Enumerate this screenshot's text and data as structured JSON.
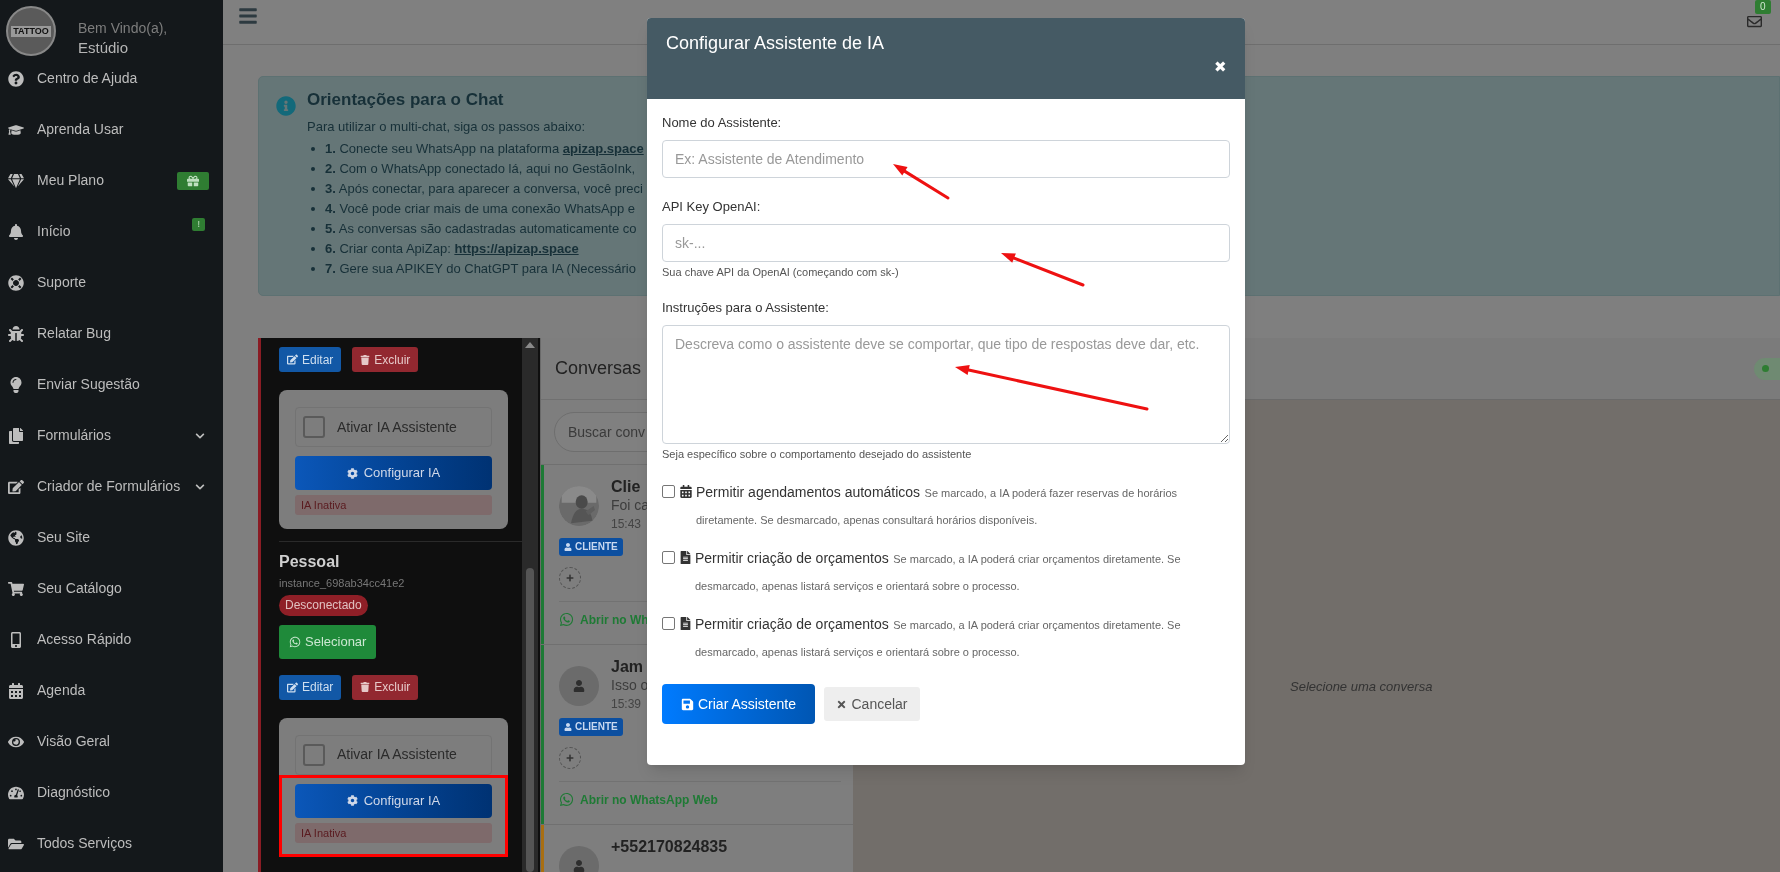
{
  "sidebar": {
    "logo_text": "TATTOO",
    "greeting": "Bem Vindo(a),",
    "user": "Estúdio",
    "items": [
      {
        "label": "Centro de Ajuda",
        "expandable": false
      },
      {
        "label": "Aprenda Usar",
        "expandable": false
      },
      {
        "label": "Meu Plano",
        "expandable": false,
        "badge": {
          "kind": "gift"
        }
      },
      {
        "label": "Início",
        "expandable": false,
        "badge": {
          "kind": "text",
          "text": "!"
        }
      },
      {
        "label": "Suporte",
        "expandable": false
      },
      {
        "label": "Relatar Bug",
        "expandable": false
      },
      {
        "label": "Enviar Sugestão",
        "expandable": false
      },
      {
        "label": "Formulários",
        "expandable": true
      },
      {
        "label": "Criador de Formulários",
        "expandable": true
      },
      {
        "label": "Seu Site",
        "expandable": false
      },
      {
        "label": "Seu Catálogo",
        "expandable": false
      },
      {
        "label": "Acesso Rápido",
        "expandable": false
      },
      {
        "label": "Agenda",
        "expandable": false
      },
      {
        "label": "Visão Geral",
        "expandable": false
      },
      {
        "label": "Diagnóstico",
        "expandable": false
      },
      {
        "label": "Todos Serviços",
        "expandable": false
      }
    ]
  },
  "topbar": {
    "mail_count": "0"
  },
  "guide": {
    "title": "Orientações para o Chat",
    "intro": "Para utilizar o multi-chat, siga os passos abaixo:",
    "steps": [
      {
        "number": "1.",
        "text": "Conecte seu WhatsApp na plataforma",
        "link": "apizap.space"
      },
      {
        "number": "2.",
        "text": "Com o WhatsApp conectado lá, aqui no GestãoInk,"
      },
      {
        "number": "3.",
        "text": "Após conectar, para aparecer a conversa, você preci"
      },
      {
        "number": "4.",
        "text": "Você pode criar mais de uma conexão WhatsApp e"
      },
      {
        "number": "5.",
        "text": "As conversas são cadastradas automaticamente co"
      },
      {
        "number": "6.",
        "text": "Criar conta ApiZap:",
        "link": "https://apizap.space"
      },
      {
        "number": "7.",
        "text": "Gere sua APIKEY do ChatGPT para IA (Necessário"
      }
    ]
  },
  "instances": [
    {
      "actions": [
        "Editar",
        "Excluir"
      ],
      "ai_card": {
        "checkbox_label": "Ativar IA Assistente",
        "checked": false,
        "button": "Configurar IA",
        "status": "IA Inativa",
        "highlighted": false
      }
    },
    {
      "name": "Pessoal",
      "id": "instance_698ab34cc41e2",
      "status": "Desconectado",
      "select_button": "Selecionar",
      "actions": [
        "Editar",
        "Excluir"
      ],
      "ai_card": {
        "checkbox_label": "Ativar IA Assistente",
        "checked": false,
        "button": "Configurar IA",
        "status": "IA Inativa",
        "highlighted": true
      }
    }
  ],
  "conversations": {
    "title": "Conversas",
    "search_placeholder": "Buscar conv",
    "items": [
      {
        "name": "Clie",
        "preview": "Foi ca",
        "time": "15:43",
        "tag": "CLIENTE",
        "link": "Abrir no Wh",
        "color": "#1d7a35"
      },
      {
        "kind": "default",
        "name": "Jam",
        "preview": "Isso o",
        "time": "15:39",
        "tag": "CLIENTE",
        "link": "Abrir no WhatsApp Web",
        "color": "#1d7a35"
      },
      {
        "kind": "default",
        "name": "+552170824835",
        "color": "#a86e12"
      }
    ]
  },
  "chat": {
    "empty_text": "Selecione uma conversa"
  },
  "modal": {
    "title": "Configurar Assistente de IA",
    "close": "✖",
    "fields": [
      {
        "kind": "input",
        "label": "Nome do Assistente:",
        "placeholder": "Ex: Assistente de Atendimento"
      },
      {
        "kind": "input",
        "label": "API Key OpenAI:",
        "placeholder": "sk-...",
        "hint": "Sua chave API da OpenAI (começando com sk-)"
      },
      {
        "kind": "textarea",
        "label": "Instruções para o Assistente:",
        "placeholder": "Descreva como o assistente deve se comportar, que tipo de respostas deve dar, etc.",
        "hint": "Seja específico sobre o comportamento desejado do assistente"
      }
    ],
    "options": [
      {
        "kind": "calendar",
        "label": "Permitir agendamentos automáticos",
        "description": "Se marcado, a IA poderá fazer reservas de horários diretamente. Se desmarcado, apenas consultará horários disponíveis.",
        "checked": false
      },
      {
        "kind": "document",
        "label": "Permitir criação de orçamentos",
        "description": "Se marcado, a IA poderá criar orçamentos diretamente. Se desmarcado, apenas listará serviços e orientará sobre o processo.",
        "checked": false
      },
      {
        "kind": "document",
        "label": "Permitir criação de orçamentos",
        "description": "Se marcado, a IA poderá criar orçamentos diretamente. Se desmarcado, apenas listará serviços e orientará sobre o processo.",
        "checked": false
      }
    ],
    "submit": "Criar Assistente",
    "cancel": "Cancelar"
  }
}
